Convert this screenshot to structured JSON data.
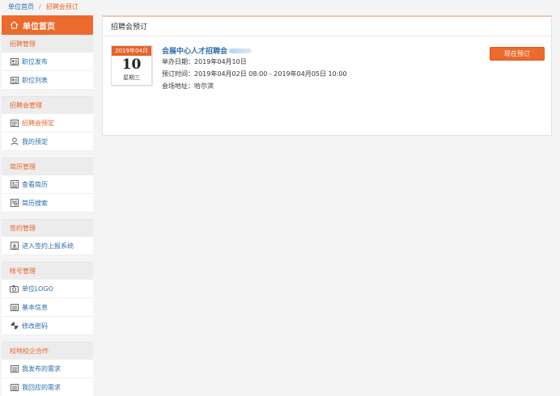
{
  "breadcrumb": {
    "home": "单位首页",
    "separator": "/",
    "current": "招聘会预订"
  },
  "sidebar": {
    "header": "单位首页",
    "groups": [
      {
        "title": "招聘管理",
        "items": [
          {
            "label": "职位发布",
            "icon": "form-icon"
          },
          {
            "label": "职位列表",
            "icon": "list-icon"
          }
        ]
      },
      {
        "title": "招聘会管理",
        "items": [
          {
            "label": "招聘会预定",
            "icon": "document-icon",
            "active": true
          },
          {
            "label": "我的预定",
            "icon": "user-icon"
          }
        ]
      },
      {
        "title": "简历管理",
        "items": [
          {
            "label": "查看简历",
            "icon": "resume-icon"
          },
          {
            "label": "简历搜索",
            "icon": "search-doc-icon"
          }
        ]
      },
      {
        "title": "签约管理",
        "items": [
          {
            "label": "进入签约上报系统",
            "icon": "contract-icon"
          }
        ]
      },
      {
        "title": "帐号管理",
        "items": [
          {
            "label": "单位LOGO",
            "icon": "camera-icon"
          },
          {
            "label": "基本信息",
            "icon": "info-icon"
          },
          {
            "label": "修改密码",
            "icon": "password-icon"
          }
        ]
      },
      {
        "title": "校地校企合作",
        "items": [
          {
            "label": "我发布的需求",
            "icon": "publish-icon"
          },
          {
            "label": "我回应的需求",
            "icon": "reply-icon"
          }
        ]
      }
    ]
  },
  "panel": {
    "title": "招聘会预订",
    "fair": {
      "calendar": {
        "month": "2019年04月",
        "day": "10",
        "weekday": "星期三"
      },
      "name": "会展中心人才招聘会",
      "held_date": "举办日期：2019年04月10日",
      "booking_time": "预订时间：2019年04月02日 08:00 - 2019年04月05日 10:00",
      "venue": "会场地址：哈尔滨",
      "button": "现在预订"
    }
  },
  "colors": {
    "accent": "#ec6a2c",
    "link": "#2b6ea8"
  }
}
